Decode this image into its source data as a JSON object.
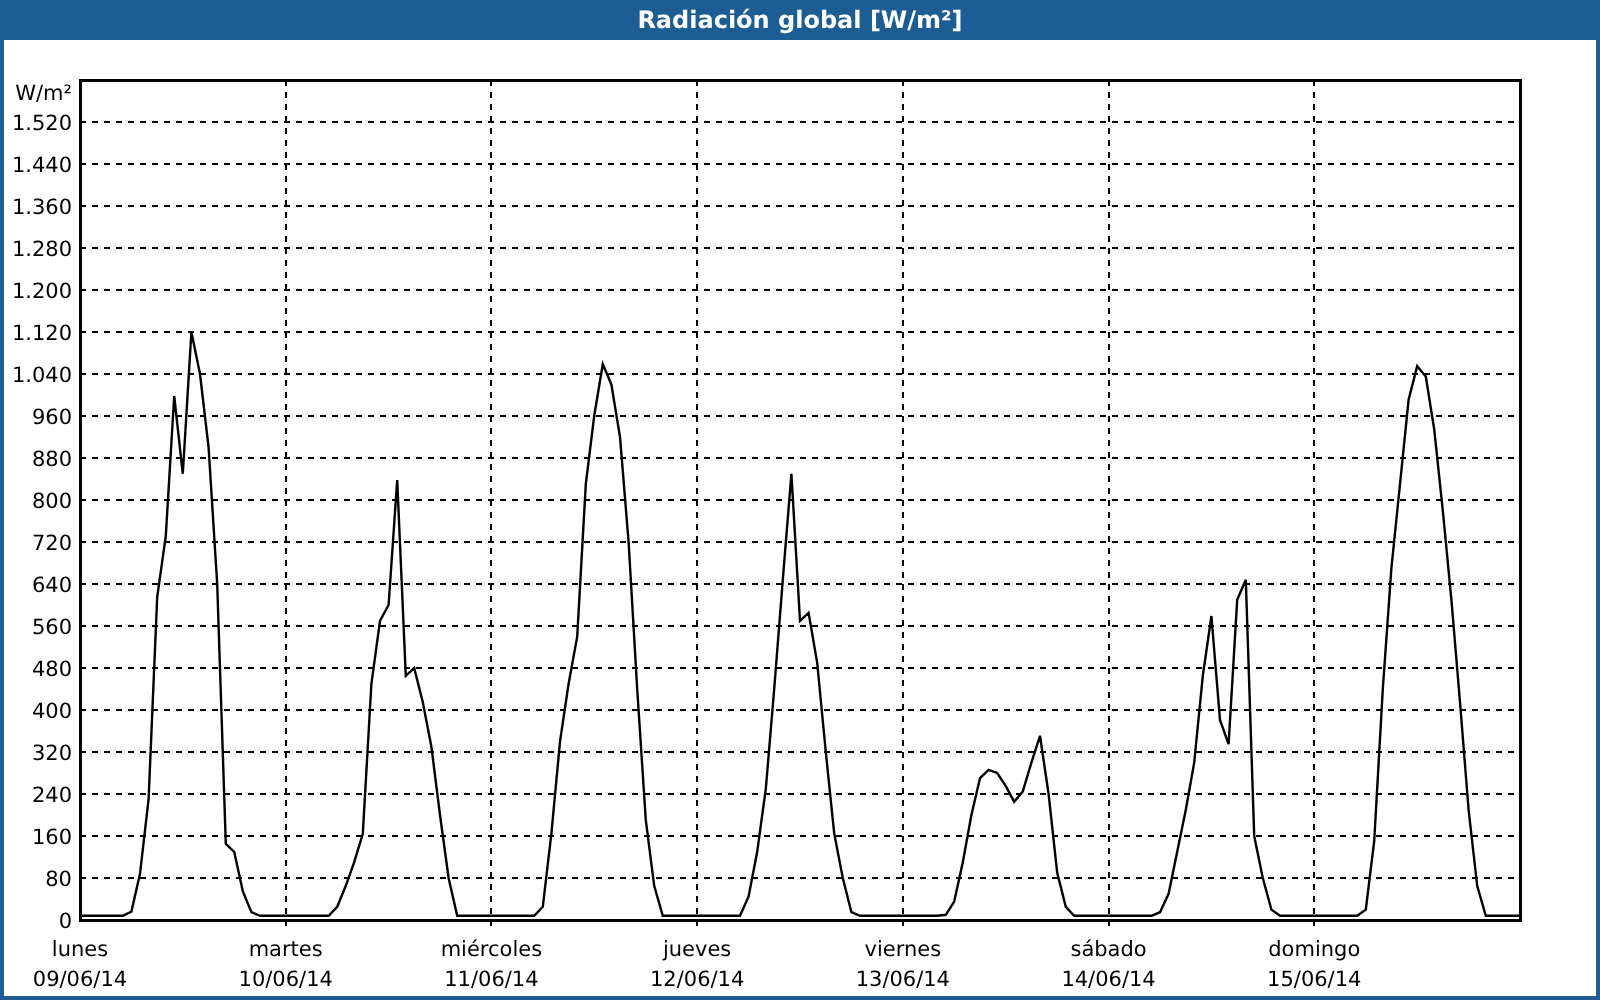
{
  "window": {
    "title": "Radiación global [W/m²]",
    "chart_data": {
      "type": "line",
      "grid": true,
      "ylabel": "W/m²",
      "ylim": [
        0,
        1600
      ],
      "categories": [
        "lunes 09/06/14",
        null,
        null,
        null,
        null,
        null,
        null,
        null,
        null,
        null,
        null,
        null,
        null,
        null,
        null,
        null,
        null,
        null,
        null,
        null,
        null,
        null,
        null,
        null,
        "martes 10/06/14",
        null,
        null,
        null,
        null,
        null,
        null,
        null,
        null,
        null,
        null,
        null,
        null,
        null,
        null,
        null,
        null,
        null,
        null,
        null,
        null,
        null,
        null,
        null,
        "miércoles 11/06/14",
        null,
        null,
        null,
        null,
        null,
        null,
        null,
        null,
        null,
        null,
        null,
        null,
        null,
        null,
        null,
        null,
        null,
        null,
        null,
        null,
        null,
        null,
        null,
        "jueves 12/06/14",
        null,
        null,
        null,
        null,
        null,
        null,
        null,
        null,
        null,
        null,
        null,
        null,
        null,
        null,
        null,
        null,
        null,
        null,
        null,
        null,
        null,
        null,
        null,
        "viernes 13/06/14",
        null,
        null,
        null,
        null,
        null,
        null,
        null,
        null,
        null,
        null,
        null,
        null,
        null,
        null,
        null,
        null,
        null,
        null,
        null,
        null,
        null,
        null,
        null,
        "sábado 14/06/14",
        null,
        null,
        null,
        null,
        null,
        null,
        null,
        null,
        null,
        null,
        null,
        null,
        null,
        null,
        null,
        null,
        null,
        null,
        null,
        null,
        null,
        null,
        null,
        "domingo 15/06/14",
        null,
        null,
        null,
        null,
        null,
        null,
        null,
        null,
        null,
        null,
        null,
        null,
        null,
        null,
        null,
        null,
        null,
        null,
        null,
        null,
        null,
        null,
        null,
        null
      ],
      "series": [
        {
          "color": "#000000",
          "values": [
            8,
            8,
            8,
            8,
            8,
            8,
            16,
            88,
            230,
            615,
            732,
            998,
            850,
            1120,
            1040,
            900,
            640,
            145,
            130,
            55,
            15,
            8,
            8,
            8,
            8,
            8,
            8,
            8,
            8,
            8,
            25,
            65,
            110,
            164,
            450,
            570,
            600,
            838,
            465,
            480,
            415,
            330,
            200,
            80,
            8,
            8,
            8,
            8,
            8,
            8,
            8,
            8,
            8,
            8,
            25,
            165,
            340,
            450,
            540,
            830,
            960,
            1059,
            1020,
            920,
            720,
            440,
            190,
            65,
            8,
            8,
            8,
            8,
            8,
            8,
            8,
            8,
            8,
            8,
            45,
            130,
            250,
            440,
            648,
            850,
            570,
            585,
            490,
            320,
            165,
            80,
            15,
            8,
            8,
            8,
            8,
            8,
            8,
            8,
            8,
            8,
            8,
            10,
            35,
            110,
            200,
            270,
            286,
            280,
            255,
            225,
            245,
            300,
            351,
            240,
            90,
            25,
            8,
            8,
            8,
            8,
            8,
            8,
            8,
            8,
            8,
            8,
            15,
            50,
            130,
            210,
            300,
            465,
            579,
            381,
            335,
            610,
            648,
            160,
            80,
            20,
            8,
            8,
            8,
            8,
            8,
            8,
            8,
            8,
            8,
            8,
            20,
            150,
            440,
            670,
            830,
            991,
            1055,
            1035,
            935,
            780,
            610,
            415,
            210,
            65,
            8,
            8,
            8,
            8,
            8
          ]
        }
      ],
      "yticks": [
        {
          "value": 0,
          "label": "0"
        },
        {
          "value": 80,
          "label": "80"
        },
        {
          "value": 160,
          "label": "160"
        },
        {
          "value": 240,
          "label": "240"
        },
        {
          "value": 320,
          "label": "320"
        },
        {
          "value": 400,
          "label": "400"
        },
        {
          "value": 480,
          "label": "480"
        },
        {
          "value": 560,
          "label": "560"
        },
        {
          "value": 640,
          "label": "640"
        },
        {
          "value": 720,
          "label": "720"
        },
        {
          "value": 800,
          "label": "800"
        },
        {
          "value": 880,
          "label": "880"
        },
        {
          "value": 960,
          "label": "960"
        },
        {
          "value": 1040,
          "label": "1.040"
        },
        {
          "value": 1120,
          "label": "1.120"
        },
        {
          "value": 1200,
          "label": "1.200"
        },
        {
          "value": 1280,
          "label": "1.280"
        },
        {
          "value": 1360,
          "label": "1.360"
        },
        {
          "value": 1440,
          "label": "1.440"
        },
        {
          "value": 1520,
          "label": "1.520"
        }
      ]
    }
  }
}
